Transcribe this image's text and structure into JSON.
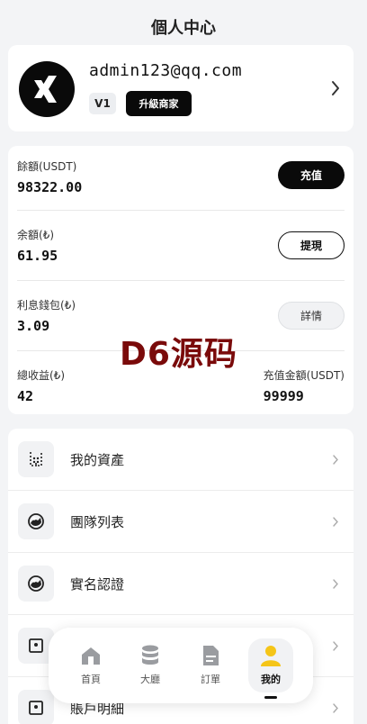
{
  "header": {
    "title": "個人中心"
  },
  "profile": {
    "email": "admin123@qq.com",
    "level": "V1",
    "upgrade_label": "升級商家",
    "avatar_icon": "xing-logo-icon",
    "chevron_icon": "chevron-right-icon"
  },
  "balance": {
    "usdt_label": "餘額(USDT)",
    "usdt_value": "98322.00",
    "recharge_label": "充值",
    "local_label": "余額(₺)",
    "local_value": "61.95",
    "withdraw_label": "提現",
    "interest_label": "利息錢包(₺)",
    "interest_value": "3.09",
    "details_label": "詳情",
    "total_income_label": "總收益(₺)",
    "total_income_value": "42",
    "total_recharge_label": "充值金額(USDT)",
    "total_recharge_value": "99999"
  },
  "watermark": "D6源码",
  "menu": {
    "items": [
      {
        "label": "我的資產",
        "icon": "wallet-icon"
      },
      {
        "label": "團隊列表",
        "icon": "team-icon"
      },
      {
        "label": "實名認證",
        "icon": "verify-icon"
      },
      {
        "label": "",
        "icon": "safe-icon"
      },
      {
        "label": "賬戶明細",
        "icon": "ledger-icon"
      }
    ]
  },
  "tabbar": {
    "tabs": [
      {
        "label": "首頁",
        "icon": "home-icon"
      },
      {
        "label": "大廳",
        "icon": "database-icon"
      },
      {
        "label": "訂單",
        "icon": "document-icon"
      },
      {
        "label": "我的",
        "icon": "user-icon"
      }
    ],
    "active_index": 3
  },
  "colors": {
    "accent": "#0a0a0a",
    "active_user": "#f5c518",
    "watermark": "#7a0a0a"
  }
}
